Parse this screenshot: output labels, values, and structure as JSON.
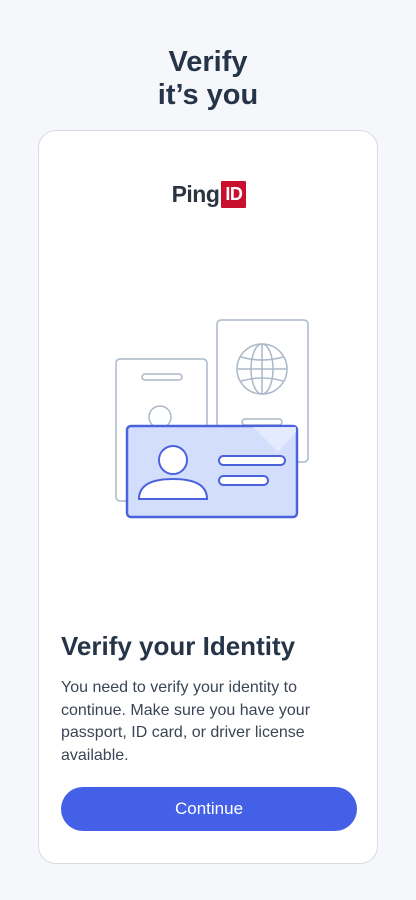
{
  "heading": {
    "line1": "Verify",
    "line2": "it’s you"
  },
  "card": {
    "logo": {
      "text": "Ping",
      "badge": "ID",
      "badge_color": "#c8102e"
    },
    "illustration": "id-documents-illustration",
    "title": "Verify your Identity",
    "description": "You need to verify your identity to continue. Make sure you have your passport, ID card, or driver license available.",
    "continue_label": "Continue"
  },
  "colors": {
    "accent": "#4360e6",
    "background": "#f5f7fb",
    "text": "#263447"
  }
}
